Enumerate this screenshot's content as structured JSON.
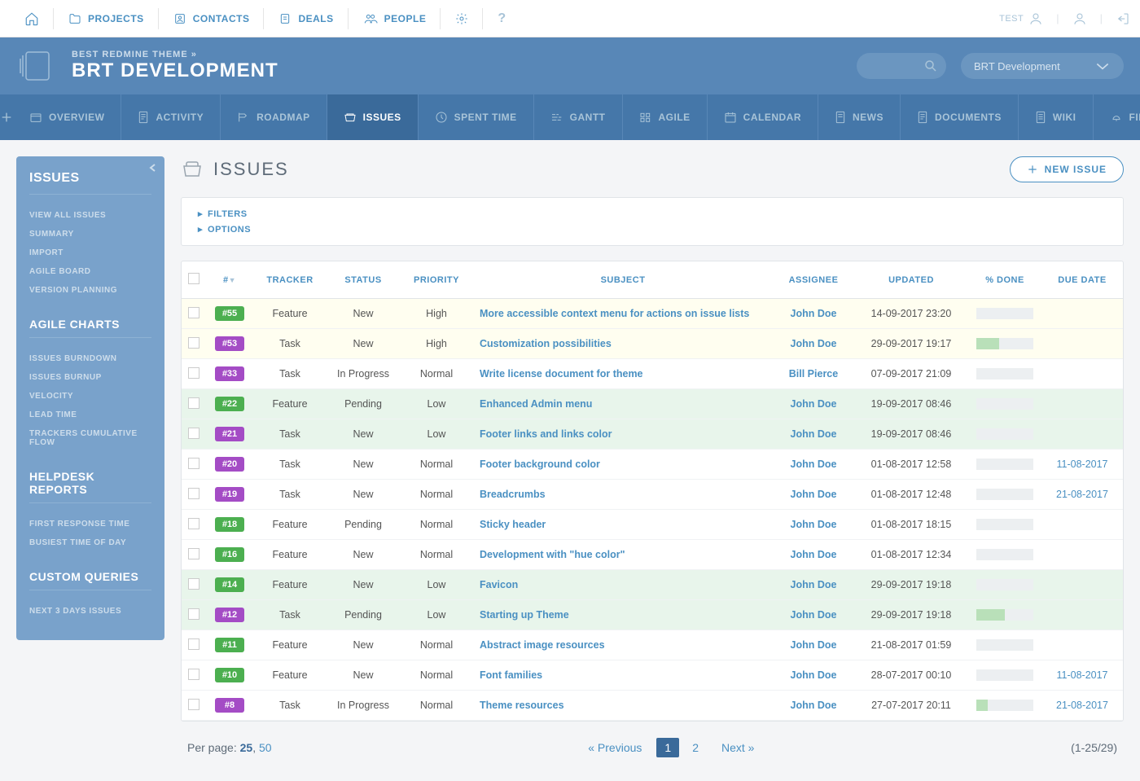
{
  "topnav": {
    "items": [
      "PROJECTS",
      "CONTACTS",
      "DEALS",
      "PEOPLE"
    ],
    "user": "TEST"
  },
  "header": {
    "breadcrumb": "BEST REDMINE THEME »",
    "title": "BRT DEVELOPMENT",
    "switcher": "BRT Development"
  },
  "tabs": [
    "OVERVIEW",
    "ACTIVITY",
    "ROADMAP",
    "ISSUES",
    "SPENT TIME",
    "GANTT",
    "AGILE",
    "CALENDAR",
    "NEWS",
    "DOCUMENTS",
    "WIKI",
    "FILES"
  ],
  "activeTab": 3,
  "sidebar": {
    "title": "ISSUES",
    "links": [
      "VIEW ALL ISSUES",
      "SUMMARY",
      "IMPORT",
      "AGILE BOARD",
      "VERSION PLANNING"
    ],
    "agileTitle": "AGILE CHARTS",
    "agileLinks": [
      "ISSUES BURNDOWN",
      "ISSUES BURNUP",
      "VELOCITY",
      "LEAD TIME",
      "TRACKERS CUMULATIVE FLOW"
    ],
    "helpdeskTitle": "HELPDESK REPORTS",
    "helpdeskLinks": [
      "FIRST RESPONSE TIME",
      "BUSIEST TIME OF DAY"
    ],
    "customTitle": "CUSTOM QUERIES",
    "customLinks": [
      "NEXT 3 DAYS ISSUES"
    ]
  },
  "page": {
    "title": "ISSUES",
    "newIssue": "NEW ISSUE",
    "filters": "FILTERS",
    "options": "OPTIONS"
  },
  "columns": [
    "#",
    "TRACKER",
    "STATUS",
    "PRIORITY",
    "SUBJECT",
    "ASSIGNEE",
    "UPDATED",
    "% DONE",
    "DUE DATE"
  ],
  "rows": [
    {
      "id": "#55",
      "pill": "green",
      "tracker": "Feature",
      "status": "New",
      "priority": "High",
      "subject": "More accessible context menu for actions on issue lists",
      "assignee": "John Doe",
      "updated": "14-09-2017 23:20",
      "done": 0,
      "due": ""
    },
    {
      "id": "#53",
      "pill": "purple",
      "tracker": "Task",
      "status": "New",
      "priority": "High",
      "subject": "Customization possibilities",
      "assignee": "John Doe",
      "updated": "29-09-2017 19:17",
      "done": 40,
      "due": ""
    },
    {
      "id": "#33",
      "pill": "purple",
      "tracker": "Task",
      "status": "In Progress",
      "priority": "Normal",
      "subject": "Write license document for theme",
      "assignee": "Bill Pierce",
      "updated": "07-09-2017 21:09",
      "done": 0,
      "due": ""
    },
    {
      "id": "#22",
      "pill": "green",
      "tracker": "Feature",
      "status": "Pending",
      "priority": "Low",
      "subject": "Enhanced Admin menu",
      "assignee": "John Doe",
      "updated": "19-09-2017 08:46",
      "done": 0,
      "due": ""
    },
    {
      "id": "#21",
      "pill": "purple",
      "tracker": "Task",
      "status": "New",
      "priority": "Low",
      "subject": "Footer links and links color",
      "assignee": "John Doe",
      "updated": "19-09-2017 08:46",
      "done": 0,
      "due": ""
    },
    {
      "id": "#20",
      "pill": "purple",
      "tracker": "Task",
      "status": "New",
      "priority": "Normal",
      "subject": "Footer background color",
      "assignee": "John Doe",
      "updated": "01-08-2017 12:58",
      "done": 0,
      "due": "11-08-2017"
    },
    {
      "id": "#19",
      "pill": "purple",
      "tracker": "Task",
      "status": "New",
      "priority": "Normal",
      "subject": "Breadcrumbs",
      "assignee": "John Doe",
      "updated": "01-08-2017 12:48",
      "done": 0,
      "due": "21-08-2017"
    },
    {
      "id": "#18",
      "pill": "green",
      "tracker": "Feature",
      "status": "Pending",
      "priority": "Normal",
      "subject": "Sticky header",
      "assignee": "John Doe",
      "updated": "01-08-2017 18:15",
      "done": 0,
      "due": ""
    },
    {
      "id": "#16",
      "pill": "green",
      "tracker": "Feature",
      "status": "New",
      "priority": "Normal",
      "subject": "Development with \"hue color\"",
      "assignee": "John Doe",
      "updated": "01-08-2017 12:34",
      "done": 0,
      "due": ""
    },
    {
      "id": "#14",
      "pill": "green",
      "tracker": "Feature",
      "status": "New",
      "priority": "Low",
      "subject": "Favicon",
      "assignee": "John Doe",
      "updated": "29-09-2017 19:18",
      "done": 0,
      "due": ""
    },
    {
      "id": "#12",
      "pill": "purple",
      "tracker": "Task",
      "status": "Pending",
      "priority": "Low",
      "subject": "Starting up Theme",
      "assignee": "John Doe",
      "updated": "29-09-2017 19:18",
      "done": 50,
      "due": ""
    },
    {
      "id": "#11",
      "pill": "green",
      "tracker": "Feature",
      "status": "New",
      "priority": "Normal",
      "subject": "Abstract image resources",
      "assignee": "John Doe",
      "updated": "21-08-2017 01:59",
      "done": 0,
      "due": ""
    },
    {
      "id": "#10",
      "pill": "green",
      "tracker": "Feature",
      "status": "New",
      "priority": "Normal",
      "subject": "Font families",
      "assignee": "John Doe",
      "updated": "28-07-2017 00:10",
      "done": 0,
      "due": "11-08-2017"
    },
    {
      "id": "#8",
      "pill": "purple",
      "tracker": "Task",
      "status": "In Progress",
      "priority": "Normal",
      "subject": "Theme resources",
      "assignee": "John Doe",
      "updated": "27-07-2017 20:11",
      "done": 20,
      "due": "21-08-2017"
    }
  ],
  "footer": {
    "perpageLabel": "Per page:",
    "perpageCurrent": "25",
    "perpageOther": "50",
    "prev": "« Previous",
    "pages": [
      "1",
      "2"
    ],
    "currentPage": 0,
    "next": "Next »",
    "count": "(1-25/29)"
  }
}
